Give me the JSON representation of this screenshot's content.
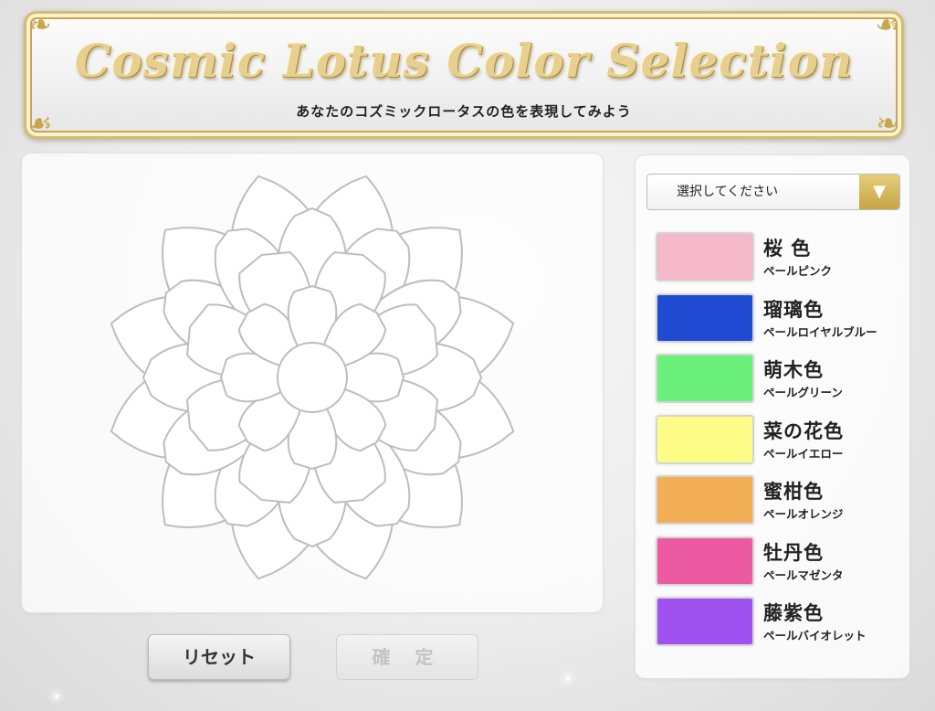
{
  "header": {
    "title": "Cosmic Lotus Color Selection",
    "subtitle": "あなたのコズミックロータスの色を表現してみよう"
  },
  "palette": {
    "select_placeholder": "選択してください",
    "colors": [
      {
        "name": "桜 色",
        "sub": "ペールピンク",
        "hex": "#f4b8c8"
      },
      {
        "name": "瑠璃色",
        "sub": "ペールロイヤルブルー",
        "hex": "#1e4bd2"
      },
      {
        "name": "萌木色",
        "sub": "ペールグリーン",
        "hex": "#6cf07c"
      },
      {
        "name": "菜の花色",
        "sub": "ペールイエロー",
        "hex": "#fcfc86"
      },
      {
        "name": "蜜柑色",
        "sub": "ペールオレンジ",
        "hex": "#f2ae54"
      },
      {
        "name": "牡丹色",
        "sub": "ペールマゼンタ",
        "hex": "#ec5aa2"
      },
      {
        "name": "藤紫色",
        "sub": "ペールバイオレット",
        "hex": "#a052f0"
      }
    ]
  },
  "buttons": {
    "reset": "リセット",
    "confirm": "確 定"
  },
  "icons": {
    "dropdown": "triangle-down-icon",
    "corner": "ornament-icon"
  },
  "colors": {
    "gold": "#c9a64b",
    "outline": "#bdbdbd"
  }
}
